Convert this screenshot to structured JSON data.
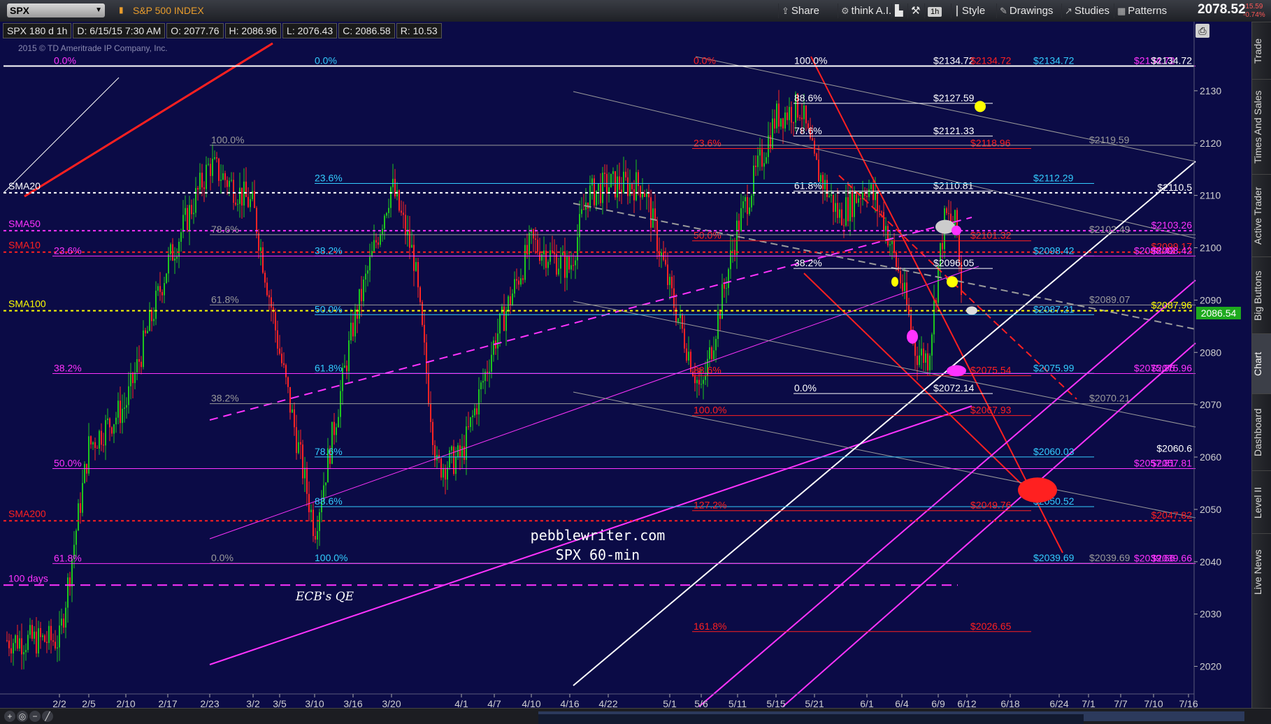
{
  "toolbar": {
    "symbol": "SPX",
    "description": "S&P 500 INDEX",
    "share_label": "Share",
    "think_label": "think A.I.",
    "timeframe_label": "1h",
    "style_label": "Style",
    "drawings_label": "Drawings",
    "studies_label": "Studies",
    "patterns_label": "Patterns",
    "last_price": "2078.52",
    "change": "-15.59",
    "change_pct": "-0.74%"
  },
  "infobar": {
    "symbol_period": "SPX 180 d 1h",
    "datetime": "D: 6/15/15 7:30 AM",
    "open": "O: 2077.76",
    "high": "H: 2086.96",
    "low": "L: 2076.43",
    "close": "C: 2086.58",
    "range": "R: 10.53"
  },
  "sidebar_tabs": [
    "Trade",
    "Times And Sales",
    "Active Trader",
    "Big Buttons",
    "Chart",
    "Dashboard",
    "Level II",
    "Live News"
  ],
  "colors": {
    "background": "#0b0b46",
    "up_candle": "#1ec51e",
    "down_candle": "#ff2424",
    "white": "#ffffff",
    "magenta": "#ff33ff",
    "red": "#ff2020",
    "cyan": "#33ccff",
    "gray": "#9a9a9a",
    "yellow": "#ffff00"
  },
  "chart_data": {
    "type": "candlestick",
    "watermark": "2015 © TD Ameritrade IP Company, Inc.",
    "annotation_1": "pebblewriter.com",
    "annotation_2": "SPX 60-min",
    "annotation_3": "ECB's QE",
    "ylim": [
      2015,
      2140
    ],
    "y_ticks": [
      2020,
      2030,
      2040,
      2050,
      2060,
      2070,
      2080,
      2090,
      2100,
      2110,
      2120,
      2130
    ],
    "x_ticks": [
      "2/2",
      "2/5",
      "2/10",
      "2/17",
      "2/23",
      "3/2",
      "3/5",
      "3/10",
      "3/16",
      "3/20",
      "4/1",
      "4/7",
      "4/10",
      "4/16",
      "4/22",
      "5/1",
      "5/6",
      "5/11",
      "5/15",
      "5/21",
      "6/1",
      "6/4",
      "6/9",
      "6/12",
      "6/18",
      "6/24",
      "7/1",
      "7/7",
      "7/10",
      "7/16"
    ],
    "price_badge": "2086.54",
    "price_path": [
      [
        "2/2",
        2025
      ],
      [
        "2/5",
        2062
      ],
      [
        "2/10",
        2070
      ],
      [
        "2/17",
        2097
      ],
      [
        "2/23",
        2116
      ],
      [
        "3/2",
        2108
      ],
      [
        "3/5",
        2080
      ],
      [
        "3/10",
        2046
      ],
      [
        "3/16",
        2085
      ],
      [
        "3/20",
        2112
      ],
      [
        "3/24",
        2098
      ],
      [
        "3/27",
        2058
      ],
      [
        "4/1",
        2060
      ],
      [
        "4/7",
        2082
      ],
      [
        "4/10",
        2101
      ],
      [
        "4/16",
        2096
      ],
      [
        "4/20",
        2110
      ],
      [
        "4/22",
        2112
      ],
      [
        "4/27",
        2112
      ],
      [
        "5/1",
        2092
      ],
      [
        "5/6",
        2072
      ],
      [
        "5/11",
        2104
      ],
      [
        "5/15",
        2125
      ],
      [
        "5/19",
        2127
      ],
      [
        "5/21",
        2116
      ],
      [
        "5/26",
        2106
      ],
      [
        "6/1",
        2112
      ],
      [
        "6/3",
        2105
      ],
      [
        "6/4",
        2093
      ],
      [
        "6/6",
        2080
      ],
      [
        "6/8",
        2079
      ],
      [
        "6/9",
        2096
      ],
      [
        "6/10",
        2106
      ],
      [
        "6/11",
        2104
      ],
      [
        "6/12",
        2079
      ],
      [
        "6/15",
        2086
      ]
    ],
    "moving_averages": [
      {
        "name": "SMA20",
        "value": 2110.5,
        "color": "#ffffff"
      },
      {
        "name": "SMA50",
        "value": 2103.26,
        "color": "#ff33ff"
      },
      {
        "name": "SMA10",
        "value": 2099.17,
        "color": "#ff2020"
      },
      {
        "name": "SMA100",
        "value": 2087.96,
        "color": "#ffff00"
      },
      {
        "name": "SMA200",
        "value": 2047.82,
        "color": "#ff2020"
      },
      {
        "name": "100 days",
        "value": 2035.53,
        "color": "#ff33ff"
      }
    ],
    "fib_levels_white": [
      {
        "pct": "100.0%",
        "price": "$2134.72"
      },
      {
        "pct": "88.6%",
        "price": "$2127.59"
      },
      {
        "pct": "78.6%",
        "price": "$2121.33"
      },
      {
        "pct": "61.8%",
        "price": "$2110.81"
      },
      {
        "pct": "38.2%",
        "price": "$2096.05"
      },
      {
        "pct": "0.0%",
        "price": "$2072.14"
      }
    ],
    "fib_levels_cyan": [
      {
        "pct": "0.0%",
        "price": "$2134.72"
      },
      {
        "pct": "23.6%",
        "price": "$2112.29"
      },
      {
        "pct": "38.2%",
        "price": "$2098.42"
      },
      {
        "pct": "50.0%",
        "price": "$2087.21"
      },
      {
        "pct": "61.8%",
        "price": "$2075.99"
      },
      {
        "pct": "78.6%",
        "price": "$2060.03"
      },
      {
        "pct": "88.6%",
        "price": "$2050.52"
      },
      {
        "pct": "100.0%",
        "price": "$2039.69"
      }
    ],
    "fib_levels_red": [
      {
        "pct": "0.0%",
        "price": "$2134.72"
      },
      {
        "pct": "23.6%",
        "price": "$2118.96"
      },
      {
        "pct": "50.0%",
        "price": "$2101.32"
      },
      {
        "pct": "88.6%",
        "price": "$2075.54"
      },
      {
        "pct": "100.0%",
        "price": "$2067.93"
      },
      {
        "pct": "127.2%",
        "price": "$2049.76"
      },
      {
        "pct": "161.8%",
        "price": "$2026.65"
      }
    ],
    "fib_levels_gray": [
      {
        "pct": "100.0%",
        "price": "$2119.59"
      },
      {
        "pct": "78.6%",
        "price": "$2102.49"
      },
      {
        "pct": "61.8%",
        "price": "$2089.07"
      },
      {
        "pct": "38.2%",
        "price": "$2070.21"
      },
      {
        "pct": "0.0%",
        "price": "$2039.69"
      }
    ],
    "fib_levels_magenta": [
      {
        "pct": "0.0%",
        "price": "$2134.72"
      },
      {
        "pct": "23.6%",
        "price": "$2098.42"
      },
      {
        "pct": "38.2%",
        "price": "$2075.96"
      },
      {
        "pct": "50.0%",
        "price": "$2057.81"
      },
      {
        "pct": "61.8%",
        "price": "$2039.66"
      }
    ],
    "right_labels": [
      {
        "text": "$2134.72",
        "value": 2134.72,
        "color": "#ffffff"
      },
      {
        "text": "$2110.5",
        "value": 2110.5,
        "color": "#ffffff"
      },
      {
        "text": "$2103.26",
        "value": 2103.26,
        "color": "#ff33ff"
      },
      {
        "text": "$2099.17",
        "value": 2099.17,
        "color": "#ff2020"
      },
      {
        "text": "$2098.42",
        "value": 2098.42,
        "color": "#ff33ff"
      },
      {
        "text": "$2087.96",
        "value": 2087.96,
        "color": "#ffff00"
      },
      {
        "text": "$2075.96",
        "value": 2075.96,
        "color": "#ff33ff"
      },
      {
        "text": "$2060.6",
        "value": 2060.6,
        "color": "#ffffff"
      },
      {
        "text": "$2057.81",
        "value": 2057.81,
        "color": "#ff33ff"
      },
      {
        "text": "$2047.82",
        "value": 2047.82,
        "color": "#ff2020"
      },
      {
        "text": "$2039.66",
        "value": 2039.66,
        "color": "#ff33ff"
      }
    ]
  }
}
